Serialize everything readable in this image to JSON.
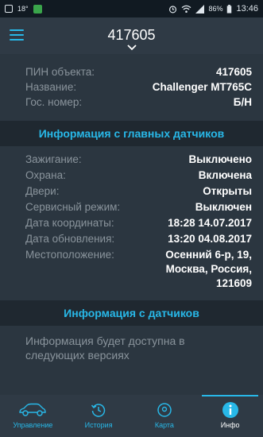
{
  "statusbar": {
    "left_text": "18°",
    "battery_percent": "86%",
    "time": "13:46"
  },
  "header": {
    "title": "417605"
  },
  "object": {
    "rows": [
      {
        "label": "ПИН объекта:",
        "value": "417605"
      },
      {
        "label": "Название:",
        "value": "Challenger MT765C"
      },
      {
        "label": "Гос. номер:",
        "value": "Б/Н"
      }
    ]
  },
  "main_sensors": {
    "heading": "Информация с главных датчиков",
    "rows": [
      {
        "label": "Зажигание:",
        "value": "Выключено"
      },
      {
        "label": "Охрана:",
        "value": "Включена"
      },
      {
        "label": "Двери:",
        "value": "Открыты"
      },
      {
        "label": "Сервисный режим:",
        "value": "Выключен"
      },
      {
        "label": "Дата координаты:",
        "value": "18:28 14.07.2017"
      },
      {
        "label": "Дата обновления:",
        "value": "13:20 04.08.2017"
      },
      {
        "label": "Местоположение:",
        "value": "Осенний 6-р, 19, Москва, Россия, 121609"
      }
    ]
  },
  "sensors": {
    "heading": "Информация с датчиков",
    "message": "Информация будет доступна в следующих версиях"
  },
  "nav": {
    "items": [
      {
        "label": "Управление",
        "icon": "car-icon"
      },
      {
        "label": "История",
        "icon": "history-icon"
      },
      {
        "label": "Карта",
        "icon": "map-pin-icon"
      },
      {
        "label": "Инфо",
        "icon": "info-icon"
      }
    ],
    "active": "Инфо"
  },
  "colors": {
    "accent": "#28b8e8",
    "background": "#2b3640",
    "section_header": "#1f2830"
  }
}
